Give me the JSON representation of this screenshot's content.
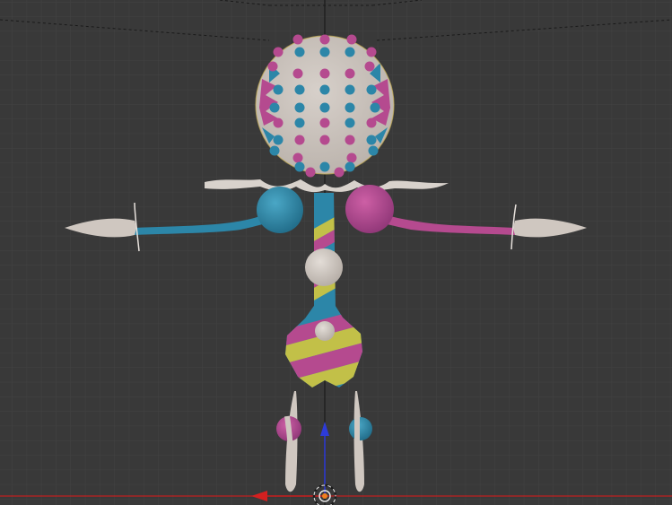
{
  "viewport": {
    "view": "front-orthographic",
    "background_color": "#393939",
    "grid": {
      "minor_color": "#424242",
      "major_color": "#4a4a4a"
    },
    "axes": {
      "x_axis_color": "#c02020",
      "z_axis_color": "#1a1a1a"
    }
  },
  "model": {
    "palette": {
      "teal": "#2c86a8",
      "magenta": "#b54a8f",
      "cream": "#cfc7c0",
      "yellow": "#c2c048"
    },
    "parts": [
      "head-sphere",
      "head-dot-markers",
      "collar-ruffle",
      "left-shoulder-ball",
      "right-shoulder-ball",
      "left-arm",
      "right-arm",
      "left-hand-leaf",
      "right-hand-leaf",
      "torso-spine",
      "chest-joint",
      "hip-joint",
      "skirt",
      "left-leg",
      "right-leg",
      "left-knee-ball",
      "right-knee-ball"
    ]
  },
  "gizmos": {
    "transform_manipulator": "translate",
    "active_axes": [
      "x",
      "z"
    ],
    "cursor": "3d-cursor"
  }
}
